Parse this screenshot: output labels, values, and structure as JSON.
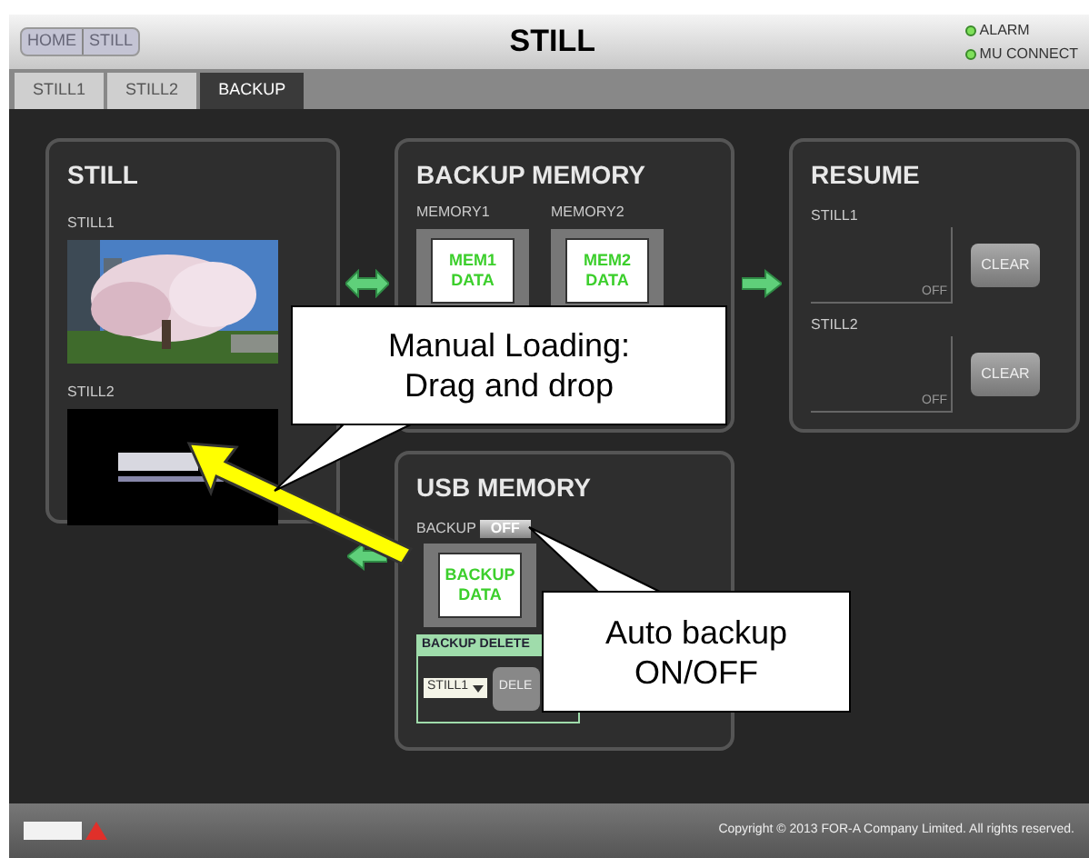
{
  "header": {
    "breadcrumbs": [
      "HOME",
      "STILL"
    ],
    "title": "STILL",
    "indicators": [
      {
        "label": "ALARM"
      },
      {
        "label": "MU CONNECT"
      }
    ]
  },
  "tabs": [
    {
      "label": "STILL1",
      "selected": false
    },
    {
      "label": "STILL2",
      "selected": false
    },
    {
      "label": "BACKUP",
      "selected": true
    }
  ],
  "still_panel": {
    "title": "STILL",
    "slots": [
      {
        "label": "STILL1",
        "kind": "picture"
      },
      {
        "label": "STILL2",
        "kind": "logo"
      }
    ]
  },
  "backup_memory": {
    "title": "BACKUP MEMORY",
    "slots": [
      {
        "label": "MEMORY1",
        "card": [
          "MEM1",
          "DATA"
        ]
      },
      {
        "label": "MEMORY2",
        "card": [
          "MEM2",
          "DATA"
        ]
      }
    ]
  },
  "resume": {
    "title": "RESUME",
    "slots": [
      {
        "label": "STILL1",
        "state": "OFF",
        "button": "CLEAR"
      },
      {
        "label": "STILL2",
        "state": "OFF",
        "button": "CLEAR"
      }
    ]
  },
  "usb_memory": {
    "title": "USB MEMORY",
    "backup_label": "BACKUP",
    "backup_toggle": "OFF",
    "card": [
      "BACKUP",
      "DATA"
    ],
    "delete": {
      "title": "BACKUP DELETE",
      "select": "STILL1",
      "button": "DELE"
    }
  },
  "callouts": [
    {
      "text": [
        "Manual Loading:",
        "Drag and drop"
      ]
    },
    {
      "text": [
        "Auto backup",
        "ON/OFF"
      ]
    }
  ],
  "footer": {
    "copyright": "Copyright © 2013 FOR-A Company Limited. All rights reserved."
  }
}
